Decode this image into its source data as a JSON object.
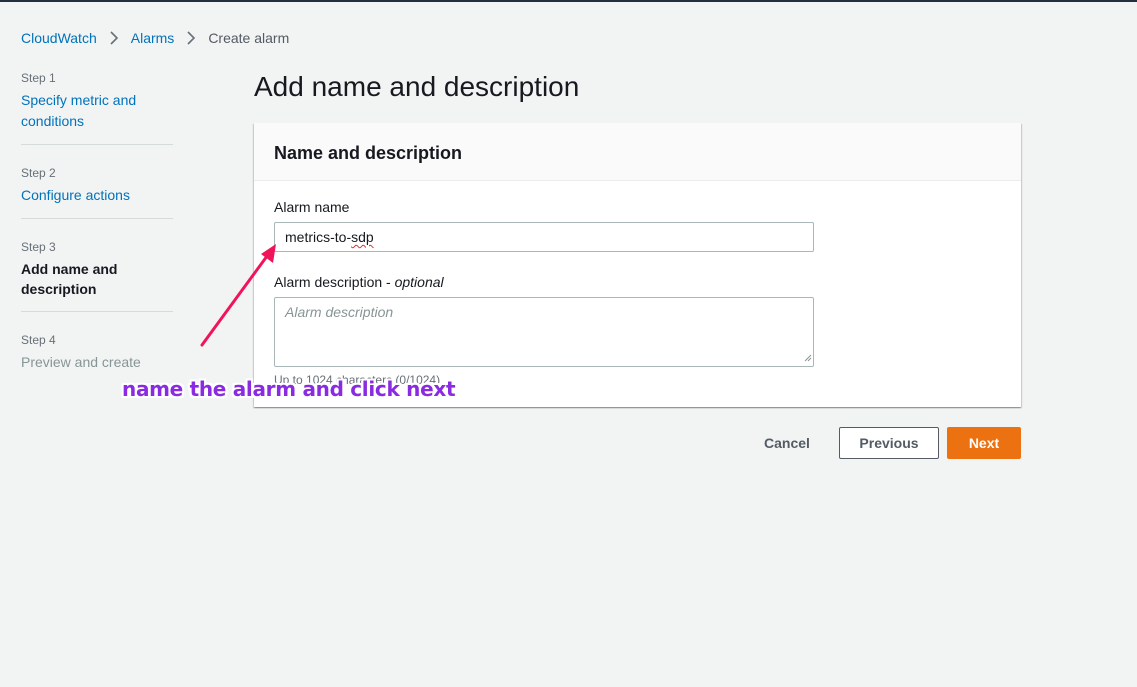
{
  "breadcrumb": {
    "items": [
      {
        "label": "CloudWatch"
      },
      {
        "label": "Alarms"
      },
      {
        "label": "Create alarm"
      }
    ]
  },
  "steps": [
    {
      "number": "Step 1",
      "title": "Specify metric and conditions",
      "state": "completed"
    },
    {
      "number": "Step 2",
      "title": "Configure actions",
      "state": "completed"
    },
    {
      "number": "Step 3",
      "title": "Add name and description",
      "state": "active"
    },
    {
      "number": "Step 4",
      "title": "Preview and create",
      "state": "disabled"
    }
  ],
  "page": {
    "title": "Add name and description"
  },
  "panel": {
    "header": "Name and description",
    "alarm_name_label": "Alarm name",
    "alarm_name_value": "metrics-to-sdp",
    "alarm_name_value_prefix": "metrics-to-",
    "alarm_name_value_misspelled": "sdp",
    "alarm_description_label": "Alarm description - ",
    "alarm_description_optional": "optional",
    "alarm_description_placeholder": "Alarm description",
    "constraint_text": "Up to 1024 characters (0/1024)"
  },
  "actions": {
    "cancel": "Cancel",
    "previous": "Previous",
    "next": "Next"
  },
  "annotation": {
    "text": "name the alarm and click next",
    "color": "#8a2be2",
    "arrow_color": "#f0145a"
  },
  "colors": {
    "link": "#0073bb",
    "primary_button": "#ec7211",
    "background": "#f2f3f3"
  }
}
